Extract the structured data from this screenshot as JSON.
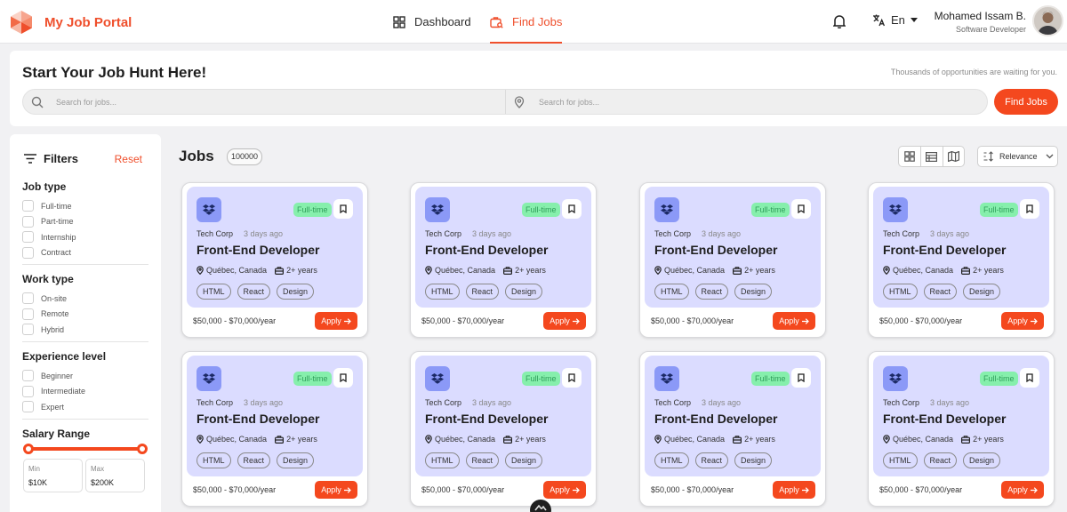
{
  "nav": {
    "brand": "My Job Portal",
    "links": {
      "dashboard": "Dashboard",
      "find_jobs": "Find Jobs"
    },
    "language": "En",
    "user": {
      "name": "Mohamed Issam B.",
      "role": "Software Developer"
    },
    "accent_color": "#ef4f2c"
  },
  "hero": {
    "title": "Start Your Job Hunt Here!",
    "subtitle": "Thousands of opportunities are waiting for you.",
    "search_placeholder": "Search for jobs...",
    "location_placeholder": "Search for jobs...",
    "button": "Find Jobs"
  },
  "filters": {
    "title": "Filters",
    "reset": "Reset",
    "job_type": {
      "title": "Job type",
      "options": [
        "Full-time",
        "Part-time",
        "Internship",
        "Contract"
      ]
    },
    "work_type": {
      "title": "Work type",
      "options": [
        "On-site",
        "Remote",
        "Hybrid"
      ]
    },
    "experience": {
      "title": "Experience level",
      "options": [
        "Beginner",
        "Intermediate",
        "Expert"
      ]
    },
    "salary": {
      "title": "Salary Range",
      "min_label": "Min",
      "min_value": "$10K",
      "max_label": "Max",
      "max_value": "$200K",
      "slider_min_fraction": 0.0,
      "slider_max_fraction": 1.0
    }
  },
  "jobs": {
    "title": "Jobs",
    "count": "100000",
    "sort_label": "Relevance",
    "cards": [
      {
        "company": "Tech Corp",
        "posted": "3 days ago",
        "type": "Full-time",
        "title": "Front-End Developer",
        "location": "Québec, Canada",
        "experience": "2+ years",
        "tags": [
          "HTML",
          "React",
          "Design"
        ],
        "salary": "$50,000 - $70,000/year",
        "apply": "Apply"
      },
      {
        "company": "Tech Corp",
        "posted": "3 days ago",
        "type": "Full-time",
        "title": "Front-End Developer",
        "location": "Québec, Canada",
        "experience": "2+ years",
        "tags": [
          "HTML",
          "React",
          "Design"
        ],
        "salary": "$50,000 - $70,000/year",
        "apply": "Apply"
      },
      {
        "company": "Tech Corp",
        "posted": "3 days ago",
        "type": "Full-time",
        "title": "Front-End Developer",
        "location": "Québec, Canada",
        "experience": "2+ years",
        "tags": [
          "HTML",
          "React",
          "Design"
        ],
        "salary": "$50,000 - $70,000/year",
        "apply": "Apply"
      },
      {
        "company": "Tech Corp",
        "posted": "3 days ago",
        "type": "Full-time",
        "title": "Front-End Developer",
        "location": "Québec, Canada",
        "experience": "2+ years",
        "tags": [
          "HTML",
          "React",
          "Design"
        ],
        "salary": "$50,000 - $70,000/year",
        "apply": "Apply"
      },
      {
        "company": "Tech Corp",
        "posted": "3 days ago",
        "type": "Full-time",
        "title": "Front-End Developer",
        "location": "Québec, Canada",
        "experience": "2+ years",
        "tags": [
          "HTML",
          "React",
          "Design"
        ],
        "salary": "$50,000 - $70,000/year",
        "apply": "Apply"
      },
      {
        "company": "Tech Corp",
        "posted": "3 days ago",
        "type": "Full-time",
        "title": "Front-End Developer",
        "location": "Québec, Canada",
        "experience": "2+ years",
        "tags": [
          "HTML",
          "React",
          "Design"
        ],
        "salary": "$50,000 - $70,000/year",
        "apply": "Apply"
      },
      {
        "company": "Tech Corp",
        "posted": "3 days ago",
        "type": "Full-time",
        "title": "Front-End Developer",
        "location": "Québec, Canada",
        "experience": "2+ years",
        "tags": [
          "HTML",
          "React",
          "Design"
        ],
        "salary": "$50,000 - $70,000/year",
        "apply": "Apply"
      },
      {
        "company": "Tech Corp",
        "posted": "3 days ago",
        "type": "Full-time",
        "title": "Front-End Developer",
        "location": "Québec, Canada",
        "experience": "2+ years",
        "tags": [
          "HTML",
          "React",
          "Design"
        ],
        "salary": "$50,000 - $70,000/year",
        "apply": "Apply"
      }
    ]
  }
}
